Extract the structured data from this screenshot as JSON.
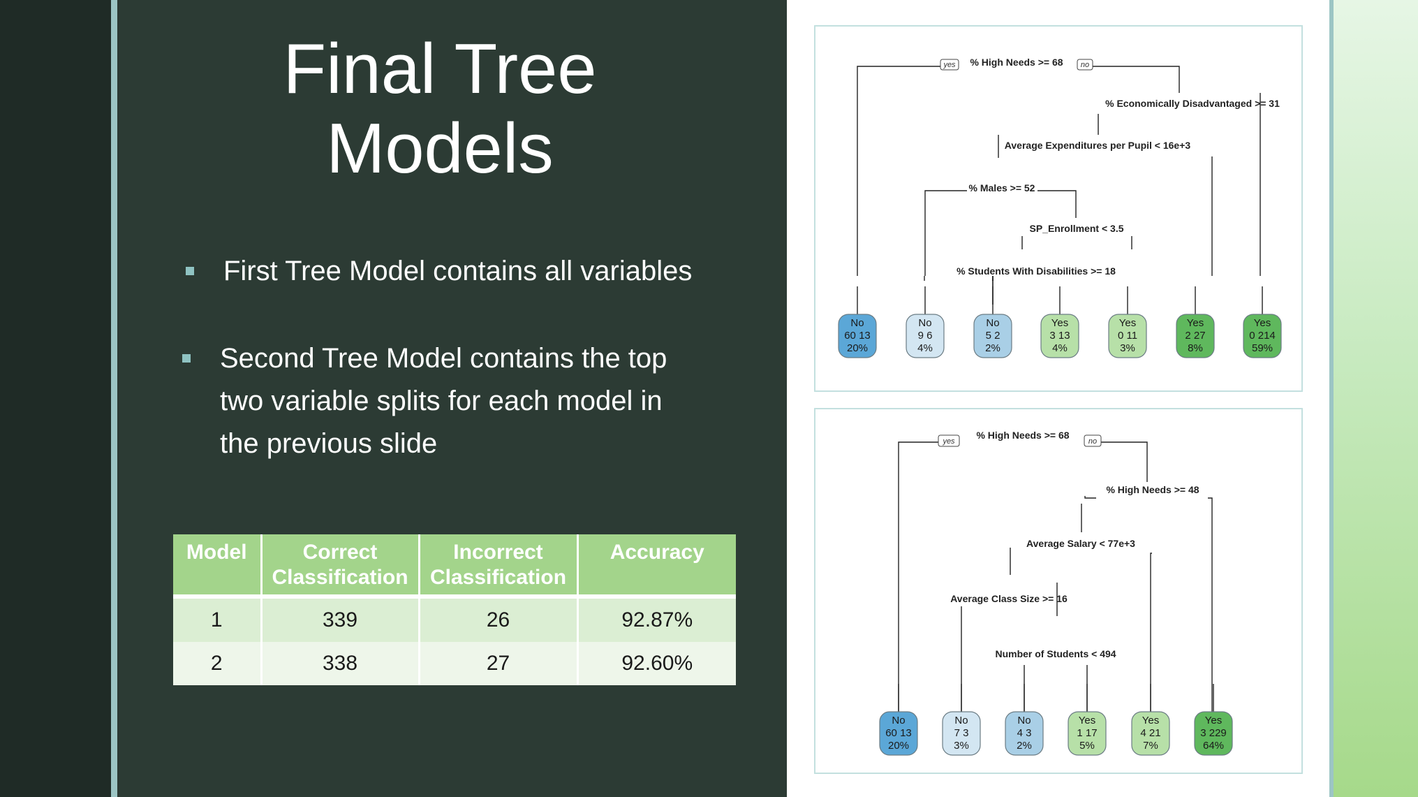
{
  "slide": {
    "title_line1": "Final Tree",
    "title_line2": "Models",
    "bullets": [
      "First Tree Model contains all variables",
      "Second Tree Model contains the top",
      "two variable splits for each model in",
      "the previous slide"
    ]
  },
  "table": {
    "headers": [
      "Model",
      "Correct Classification",
      "Incorrect Classification",
      "Accuracy"
    ],
    "rows": [
      [
        "1",
        "339",
        "26",
        "92.87%"
      ],
      [
        "2",
        "338",
        "27",
        "92.60%"
      ]
    ]
  },
  "trees": [
    {
      "yes_label": "yes",
      "no_label": "no",
      "splits": [
        "% High Needs >= 68",
        "% Economically Disadvantaged >= 31",
        "Average Expenditures per Pupil < 16e+3",
        "% Males >= 52",
        "SP_Enrollment < 3.5",
        "% Students With Disabilities >= 18"
      ],
      "leaves": [
        {
          "class": "No",
          "counts": "60  13",
          "pct": "20%"
        },
        {
          "class": "No",
          "counts": "9  6",
          "pct": "4%"
        },
        {
          "class": "No",
          "counts": "5  2",
          "pct": "2%"
        },
        {
          "class": "Yes",
          "counts": "3  13",
          "pct": "4%"
        },
        {
          "class": "Yes",
          "counts": "0  11",
          "pct": "3%"
        },
        {
          "class": "Yes",
          "counts": "2  27",
          "pct": "8%"
        },
        {
          "class": "Yes",
          "counts": "0  214",
          "pct": "59%"
        }
      ]
    },
    {
      "yes_label": "yes",
      "no_label": "no",
      "splits": [
        "% High Needs >= 68",
        "% High Needs >= 48",
        "Average Salary < 77e+3",
        "Average Class Size >= 16",
        "Number of Students < 494"
      ],
      "leaves": [
        {
          "class": "No",
          "counts": "60  13",
          "pct": "20%"
        },
        {
          "class": "No",
          "counts": "7  3",
          "pct": "3%"
        },
        {
          "class": "No",
          "counts": "4  3",
          "pct": "2%"
        },
        {
          "class": "Yes",
          "counts": "1  17",
          "pct": "5%"
        },
        {
          "class": "Yes",
          "counts": "4  21",
          "pct": "7%"
        },
        {
          "class": "Yes",
          "counts": "3  229",
          "pct": "64%"
        }
      ]
    }
  ],
  "colors": {
    "no_strong": "#5ba7d7",
    "no_light": "#d3e6f2",
    "yes_light": "#b7e0a8",
    "yes_strong": "#5fb85d",
    "header_green": "#a3d48b"
  }
}
